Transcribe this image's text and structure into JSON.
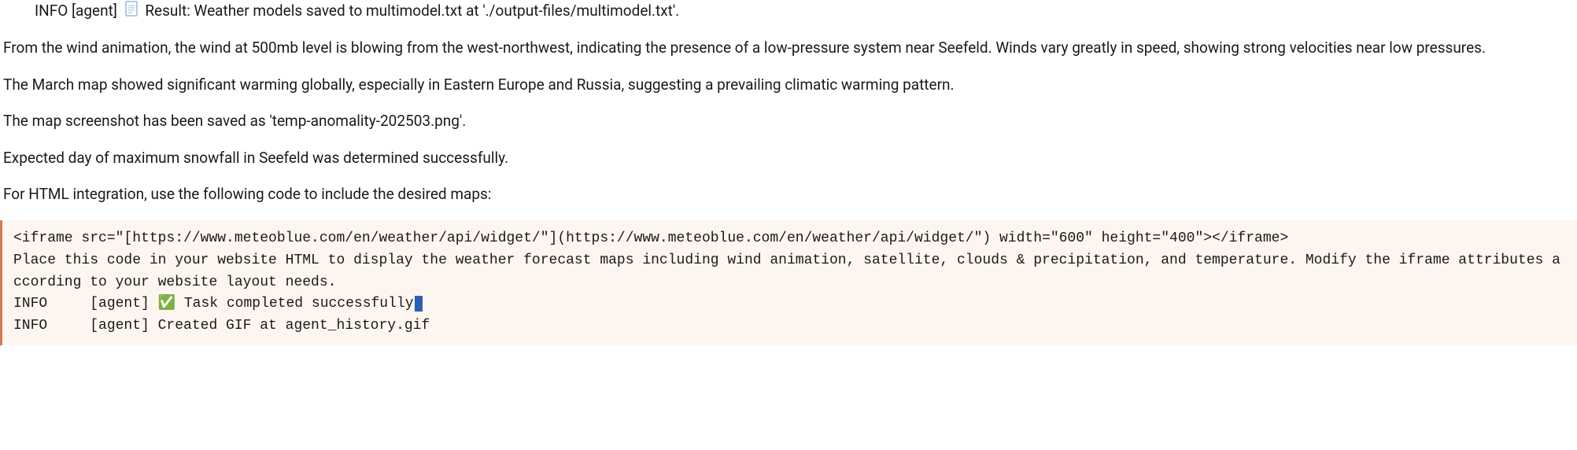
{
  "logLine": {
    "prefix": "INFO [agent]",
    "result": " Result: Weather models saved to multimodel.txt at './output-files/multimodel.txt'."
  },
  "paragraphs": [
    "From the wind animation, the wind at 500mb level is blowing from the west-northwest, indicating the presence of a low-pressure system near Seefeld. Winds vary greatly in speed, showing strong velocities near low pressures.",
    "The March map showed significant warming globally, especially in Eastern Europe and Russia, suggesting a prevailing climatic warming pattern.",
    "The map screenshot has been saved as 'temp-anomality-202503.png'.",
    "Expected day of maximum snowfall in Seefeld was determined successfully.",
    "For HTML integration, use the following code to include the desired maps:"
  ],
  "code": {
    "line1": "<iframe src=\"[https://www.meteoblue.com/en/weather/api/widget/\"](https://www.meteoblue.com/en/weather/api/widget/\") width=\"600\" height=\"400\"></iframe>",
    "line2": "Place this code in your website HTML to display the weather forecast maps including wind animation, satellite, clouds & precipitation, and temperature. Modify the iframe attributes according to your website layout needs.",
    "line3prefix": "INFO     [agent] ",
    "line3check": "✅",
    "line3text": " Task completed successfully",
    "line4": "INFO     [agent] Created GIF at agent_history.gif"
  }
}
